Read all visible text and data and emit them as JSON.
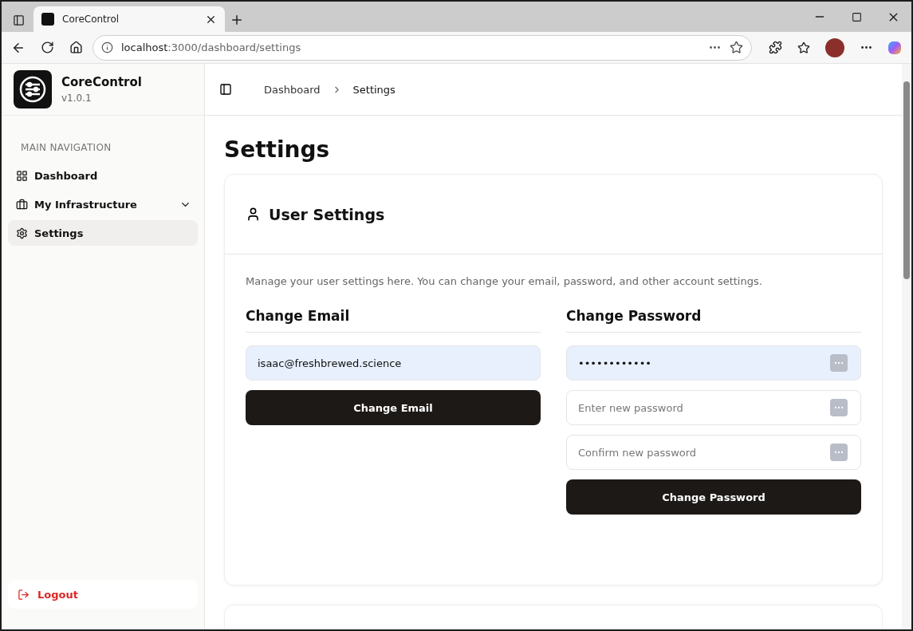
{
  "browser": {
    "tab_title": "CoreControl",
    "url_host": "localhost",
    "url_path": ":3000/dashboard/settings"
  },
  "sidebar": {
    "app_name": "CoreControl",
    "version": "v1.0.1",
    "section_label": "MAIN NAVIGATION",
    "items": [
      {
        "kind": "dashboard",
        "label": "Dashboard",
        "selected": false
      },
      {
        "kind": "infrastructure",
        "label": "My Infrastructure",
        "selected": false,
        "expanded": false
      },
      {
        "kind": "settings",
        "label": "Settings",
        "selected": true
      }
    ],
    "logout": "Logout"
  },
  "breadcrumb": [
    "Dashboard",
    "Settings"
  ],
  "page_title": "Settings",
  "card": {
    "title": "User Settings",
    "description": "Manage your user settings here. You can change your email, password, and other account settings.",
    "email": {
      "heading": "Change Email",
      "value": "isaac@freshbrewed.science",
      "button": "Change Email"
    },
    "password": {
      "heading": "Change Password",
      "fields": [
        {
          "value": "••••••••••••",
          "filled": true
        },
        {
          "placeholder": "Enter new password",
          "filled": false
        },
        {
          "placeholder": "Confirm new password",
          "filled": false
        }
      ],
      "button": "Change Password"
    }
  }
}
